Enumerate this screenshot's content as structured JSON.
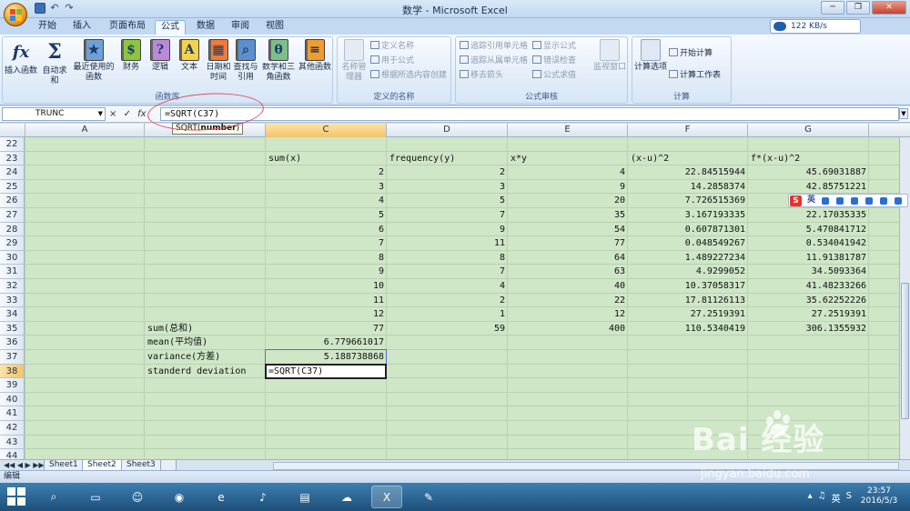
{
  "window": {
    "title": "数学 - Microsoft Excel",
    "buttons": [
      "─",
      "❐",
      "✕"
    ]
  },
  "ribbon_tabs": [
    "开始",
    "插入",
    "页面布局",
    "公式",
    "数据",
    "审阅",
    "视图"
  ],
  "active_tab": "公式",
  "speed_indicator": "122 KB/s",
  "ribbon": {
    "function_library": {
      "group_label": "函数库",
      "buttons": [
        {
          "label": "插入函数",
          "icon": "fx-icon",
          "glyph": "fx"
        },
        {
          "label": "自动求和",
          "icon": "sigma-icon",
          "glyph": "Σ"
        },
        {
          "label": "最近使用的函数",
          "icon": "recent-book-icon",
          "glyph": "★"
        },
        {
          "label": "财务",
          "icon": "finance-book-icon",
          "glyph": "$"
        },
        {
          "label": "逻辑",
          "icon": "logic-book-icon",
          "glyph": "?"
        },
        {
          "label": "文本",
          "icon": "text-book-icon",
          "glyph": "A"
        },
        {
          "label": "日期和时间",
          "icon": "date-book-icon",
          "glyph": "▦"
        },
        {
          "label": "查找与引用",
          "icon": "lookup-book-icon",
          "glyph": "⌕"
        },
        {
          "label": "数学和三角函数",
          "icon": "math-book-icon",
          "glyph": "θ"
        },
        {
          "label": "其他函数",
          "icon": "more-books-icon",
          "glyph": "≡"
        }
      ]
    },
    "defined_names": {
      "group_label": "定义的名称",
      "name_manager": "名称管理器",
      "items": [
        "定义名称",
        "用于公式",
        "根据所选内容创建"
      ]
    },
    "formula_auditing": {
      "group_label": "公式审核",
      "items_left": [
        "追踪引用单元格",
        "追踪从属单元格",
        "移去箭头"
      ],
      "items_right": [
        "显示公式",
        "错误检查",
        "公式求值"
      ],
      "watch_window": "监视窗口"
    },
    "calculation": {
      "group_label": "计算",
      "options": "计算选项",
      "calc_now": "开始计算",
      "calc_sheet": "计算工作表"
    }
  },
  "formula_bar": {
    "name_box": "TRUNC",
    "controls": [
      "×",
      "✓",
      "fx"
    ],
    "formula": "=SQRT(C37)"
  },
  "tooltip": {
    "fn": "SQRT(",
    "arg": "number",
    "close": ")"
  },
  "columns": [
    "A",
    "B",
    "C",
    "D",
    "E",
    "F",
    "G"
  ],
  "selected_column": "C",
  "rows": [
    "22",
    "23",
    "24",
    "25",
    "26",
    "27",
    "28",
    "29",
    "30",
    "31",
    "32",
    "33",
    "34",
    "35",
    "36",
    "37",
    "38",
    "39",
    "40",
    "41",
    "42",
    "43",
    "44"
  ],
  "selected_row": "38",
  "headers_row23": {
    "C": "sum(x)",
    "D": "frequency(y)",
    "E": "x*y",
    "F": "(x-u)^2",
    "G": "f*(x-u)^2"
  },
  "table": [
    {
      "row": "24",
      "C": "2",
      "D": "2",
      "E": "4",
      "F": "22.84515944",
      "G": "45.69031887"
    },
    {
      "row": "25",
      "C": "3",
      "D": "3",
      "E": "9",
      "F": "14.2858374",
      "G": "42.85751221"
    },
    {
      "row": "26",
      "C": "4",
      "D": "5",
      "E": "20",
      "F": "7.726515369",
      "G": "38.63257685"
    },
    {
      "row": "27",
      "C": "5",
      "D": "7",
      "E": "35",
      "F": "3.167193335",
      "G": "22.17035335"
    },
    {
      "row": "28",
      "C": "6",
      "D": "9",
      "E": "54",
      "F": "0.607871301",
      "G": "5.470841712"
    },
    {
      "row": "29",
      "C": "7",
      "D": "11",
      "E": "77",
      "F": "0.048549267",
      "G": "0.534041942"
    },
    {
      "row": "30",
      "C": "8",
      "D": "8",
      "E": "64",
      "F": "1.489227234",
      "G": "11.91381787"
    },
    {
      "row": "31",
      "C": "9",
      "D": "7",
      "E": "63",
      "F": "4.9299052",
      "G": "34.5093364"
    },
    {
      "row": "32",
      "C": "10",
      "D": "4",
      "E": "40",
      "F": "10.37058317",
      "G": "41.48233266"
    },
    {
      "row": "33",
      "C": "11",
      "D": "2",
      "E": "22",
      "F": "17.81126113",
      "G": "35.62252226"
    },
    {
      "row": "34",
      "C": "12",
      "D": "1",
      "E": "12",
      "F": "27.2519391",
      "G": "27.2519391"
    },
    {
      "row": "35",
      "C": "77",
      "D": "59",
      "E": "400",
      "F": "110.5340419",
      "G": "306.1355932"
    }
  ],
  "labels": {
    "sum": "sum(总和)",
    "mean": "mean(平均值)",
    "variance": "variance(方差)",
    "stddev": "standerd deviation"
  },
  "mean_value": "6.779661017",
  "variance_value": "5.188738868",
  "editing_cell_value": "=SQRT(C37)",
  "sheet_tabs": [
    "Sheet1",
    "Sheet2",
    "Sheet3"
  ],
  "active_sheet": "Sheet2",
  "status_bar": {
    "mode": "编辑"
  },
  "ime_bar": {
    "logo": "S",
    "lang": "英"
  },
  "watermark": {
    "brand": "Bai  经验",
    "url": "jingyan.baidu.com"
  },
  "taskbar": {
    "tray_lang": "英",
    "time": "23:57",
    "date": "2016/5/3"
  },
  "colors": {
    "sheet_bg": "#cfe6c7",
    "ribbon_blue": "#c3d9f1",
    "selection_header": "#f3c468",
    "annotation_circle": "#e0506a",
    "taskbar": "#1d4f7a"
  }
}
